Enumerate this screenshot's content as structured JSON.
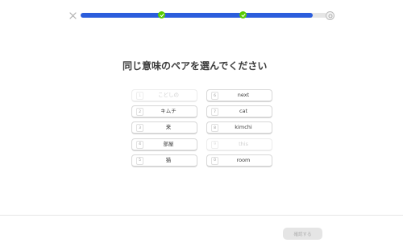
{
  "header": {
    "progress_percent": 94,
    "milestones_percent": [
      33,
      66
    ]
  },
  "prompt": {
    "title": "同じ意味のペアを選んでください"
  },
  "left_column": [
    {
      "number": "1",
      "label": "こどしの",
      "state": "disabled"
    },
    {
      "number": "2",
      "label": "キムチ",
      "state": "default"
    },
    {
      "number": "3",
      "label": "来",
      "state": "default"
    },
    {
      "number": "4",
      "label": "部屋",
      "state": "default"
    },
    {
      "number": "5",
      "label": "猫",
      "state": "default"
    }
  ],
  "right_column": [
    {
      "number": "6",
      "label": "next",
      "state": "default"
    },
    {
      "number": "7",
      "label": "cat",
      "state": "default"
    },
    {
      "number": "8",
      "label": "kimchi",
      "state": "default"
    },
    {
      "number": "9",
      "label": "this",
      "state": "disabled"
    },
    {
      "number": "0",
      "label": "room",
      "state": "default"
    }
  ],
  "footer": {
    "confirm_label": "確認する"
  },
  "colors": {
    "progress_fill": "#2b5ddc",
    "milestone": "#58cc02",
    "disabled_button": "#e5e5e5"
  },
  "icons": {
    "close": "close-icon",
    "milestone": "check-icon",
    "end": "badge-icon"
  }
}
